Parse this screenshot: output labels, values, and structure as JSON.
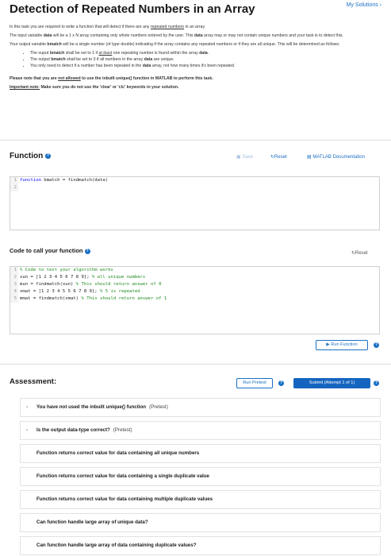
{
  "header": {
    "title": "Detection of Repeated Numbers in an Array",
    "my_solutions": "My Solutions ›"
  },
  "description": {
    "p1_a": "In this task you are required to write a function that will detect if there are any ",
    "p1_u": "repeated numbers",
    "p1_b": " in an array.",
    "p2_a": "The input variable ",
    "p2_data": "data",
    "p2_b": " will be a 1 x N array containing only whole numbers entered by the user. This ",
    "p2_data2": "data",
    "p2_c": " array may or may not contain unique numbers and your task is to detect this.",
    "p3_a": "Your output variable ",
    "p3_b": "bmatch",
    "p3_c": " will be a single number (of type double) indicating if the array contains any repeated numbers or if they are all unique. This will be determined as follows:",
    "bullet1_a": "The ouput ",
    "bullet1_b": "bmatch",
    "bullet1_c": " shall be set to 1 if ",
    "bullet1_u": "at least",
    "bullet1_d": " one repeating number is found within the array ",
    "bullet1_e": "data",
    "bullet1_f": ".",
    "bullet2_a": "The output ",
    "bullet2_b": "bmatch",
    "bullet2_c": " shall be set to 0 if all numbers in the array ",
    "bullet2_d": "data",
    "bullet2_e": " are unique.",
    "bullet3_a": "You only need to detect if a number has been repeated in the ",
    "bullet3_b": "data",
    "bullet3_c": " array, not how many times it's been repeated.",
    "note1_a": "Please note that you are ",
    "note1_u": "not allowed",
    "note1_b": " to use the inbuilt unique() function in MATLAB to perform this task.",
    "note2_u": "Important note:",
    "note2_b": " Make sure you do not use the 'clear' or 'clc' keywords in your solution."
  },
  "function_section": {
    "title": "Function",
    "save": "Save",
    "reset": "Reset",
    "docs": "MATLAB Documentation",
    "lines": [
      {
        "n": "1",
        "kw": "function",
        "rest": " bmatch = findmatch(data)"
      },
      {
        "n": "2",
        "kw": "",
        "rest": ""
      }
    ]
  },
  "call_section": {
    "title": "Code to call your function",
    "reset": "Reset",
    "lines": [
      {
        "n": "1",
        "code": "",
        "comment": "% Code to test your algorithm works"
      },
      {
        "n": "2",
        "code": "xun = [1 2 3 4 5 6 7 8 9]; ",
        "comment": "% all unique numbers"
      },
      {
        "n": "3",
        "code": "mun = findmatch(xun) ",
        "comment": "% This should return answer of 0"
      },
      {
        "n": "4",
        "code": "xmat = [1 2 3 4 5 5 6 7 8 9]; ",
        "comment": "% 5 is repeated"
      },
      {
        "n": "5",
        "code": "mmat = findmatch(xmat) ",
        "comment": "% This should return answer of 1"
      }
    ],
    "run_function": "Run Function"
  },
  "assessment": {
    "title": "Assessment:",
    "run_pretest": "Run Pretest",
    "submit": "Submit  (Attempt 1 of 1)",
    "items": [
      {
        "label": "You have not used the inbuilt unique() function",
        "tag": "(Pretest)"
      },
      {
        "label": "Is the output data-type correct?",
        "tag": "(Pretest)"
      },
      {
        "label": "Function returns correct value for data containing all unique numbers",
        "tag": ""
      },
      {
        "label": "Function returns correct value for data containing a single duplicate value",
        "tag": ""
      },
      {
        "label": "Function returns correct value for data containing multiple duplicate values",
        "tag": ""
      },
      {
        "label": "Can function handle large array of unique data?",
        "tag": ""
      },
      {
        "label": "Can function handle large array of data containing duplicate values?",
        "tag": ""
      }
    ]
  },
  "colors": {
    "accent": "#1a6fc4",
    "submit_bg": "#1565c0",
    "comment": "#228b22",
    "keyword": "#0000ff"
  }
}
